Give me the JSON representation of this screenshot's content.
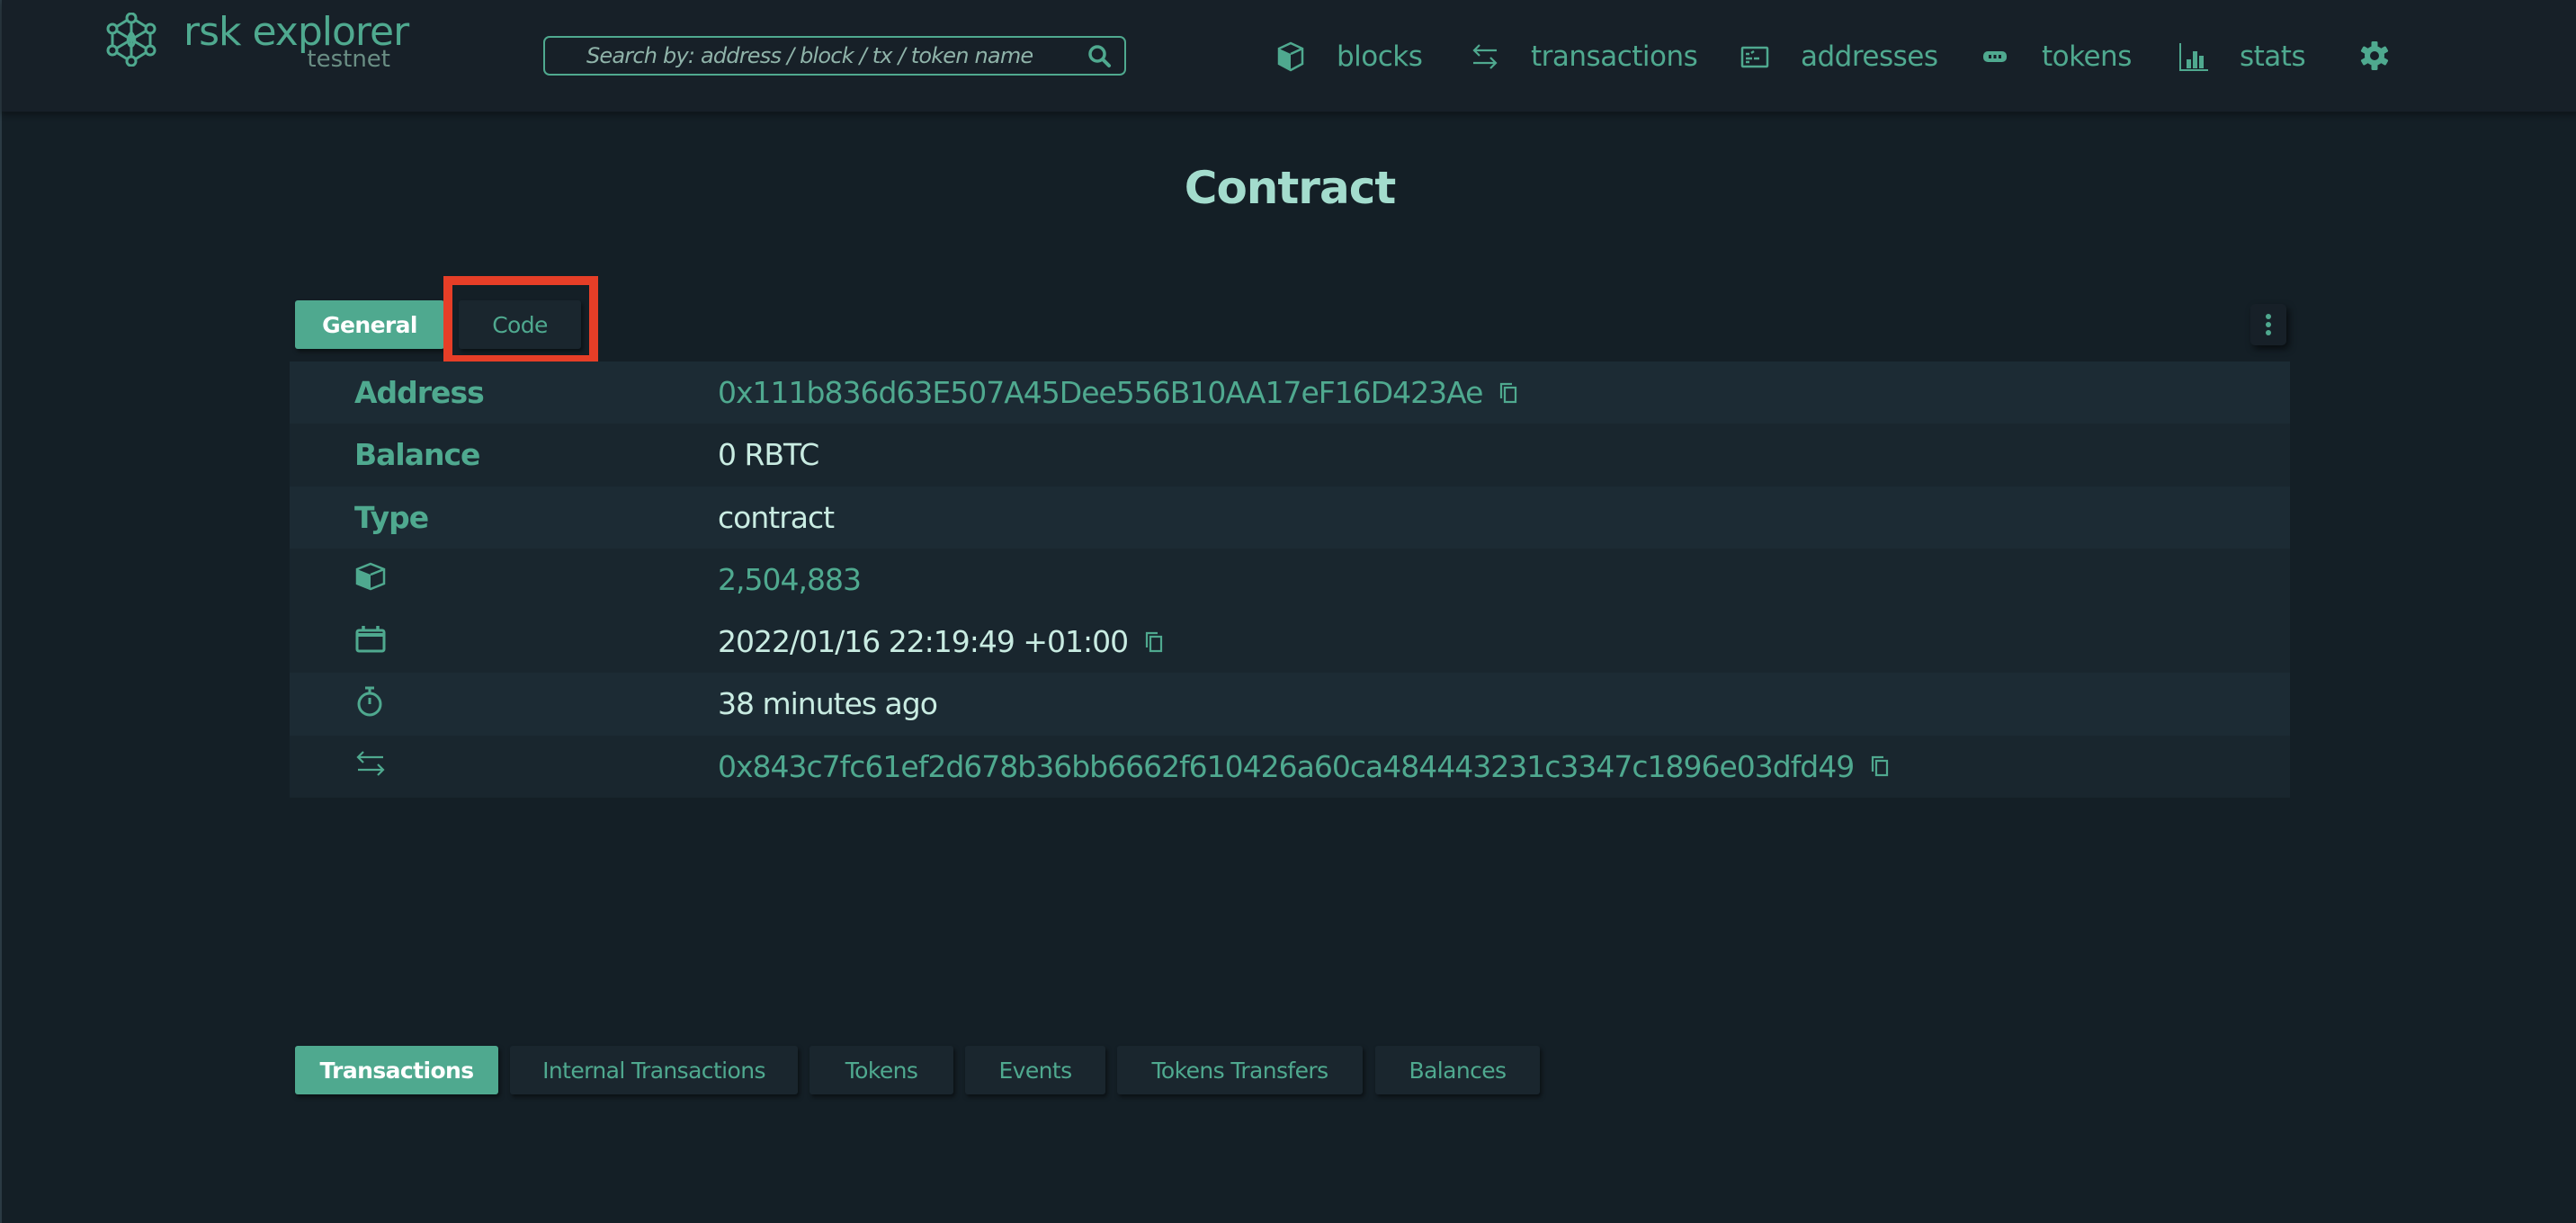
{
  "header": {
    "logo_title": "rsk explorer",
    "logo_subtitle": "testnet",
    "search_placeholder": "Search by: address / block / tx / token name",
    "nav": [
      {
        "label": "blocks",
        "icon": "cube-icon"
      },
      {
        "label": "transactions",
        "icon": "swap-arrows-icon"
      },
      {
        "label": "addresses",
        "icon": "address-card-icon"
      },
      {
        "label": "tokens",
        "icon": "token-icon"
      },
      {
        "label": "stats",
        "icon": "bar-chart-icon"
      }
    ],
    "settings_icon": "gear-icon"
  },
  "page": {
    "title": "Contract"
  },
  "detail_tabs": [
    {
      "label": "General",
      "active": true
    },
    {
      "label": "Code",
      "active": false,
      "highlighted": true
    }
  ],
  "details": {
    "address": {
      "label": "Address",
      "value": "0x111b836d63E507A45Dee556B10AA17eF16D423Ae"
    },
    "balance": {
      "label": "Balance",
      "value": "0 RBTC"
    },
    "type": {
      "label": "Type",
      "value": "contract"
    },
    "block": {
      "icon": "cube-icon",
      "value": "2,504,883"
    },
    "timestamp": {
      "icon": "calendar-icon",
      "value": "2022/01/16 22:19:49 +01:00"
    },
    "age": {
      "icon": "stopwatch-icon",
      "value": "38 minutes ago"
    },
    "tx": {
      "icon": "swap-arrows-icon",
      "value": "0x843c7fc61ef2d678b36bb6662f610426a60ca484443231c3347c1896e03dfd49"
    }
  },
  "bottom_tabs": [
    {
      "label": "Transactions",
      "active": true
    },
    {
      "label": "Internal Transactions",
      "active": false
    },
    {
      "label": "Tokens",
      "active": false
    },
    {
      "label": "Events",
      "active": false
    },
    {
      "label": "Tokens Transfers",
      "active": false
    },
    {
      "label": "Balances",
      "active": false
    }
  ],
  "colors": {
    "accent": "#4fa98f",
    "background": "#141f26",
    "title": "#a3dccd",
    "highlight": "#e63e27"
  }
}
